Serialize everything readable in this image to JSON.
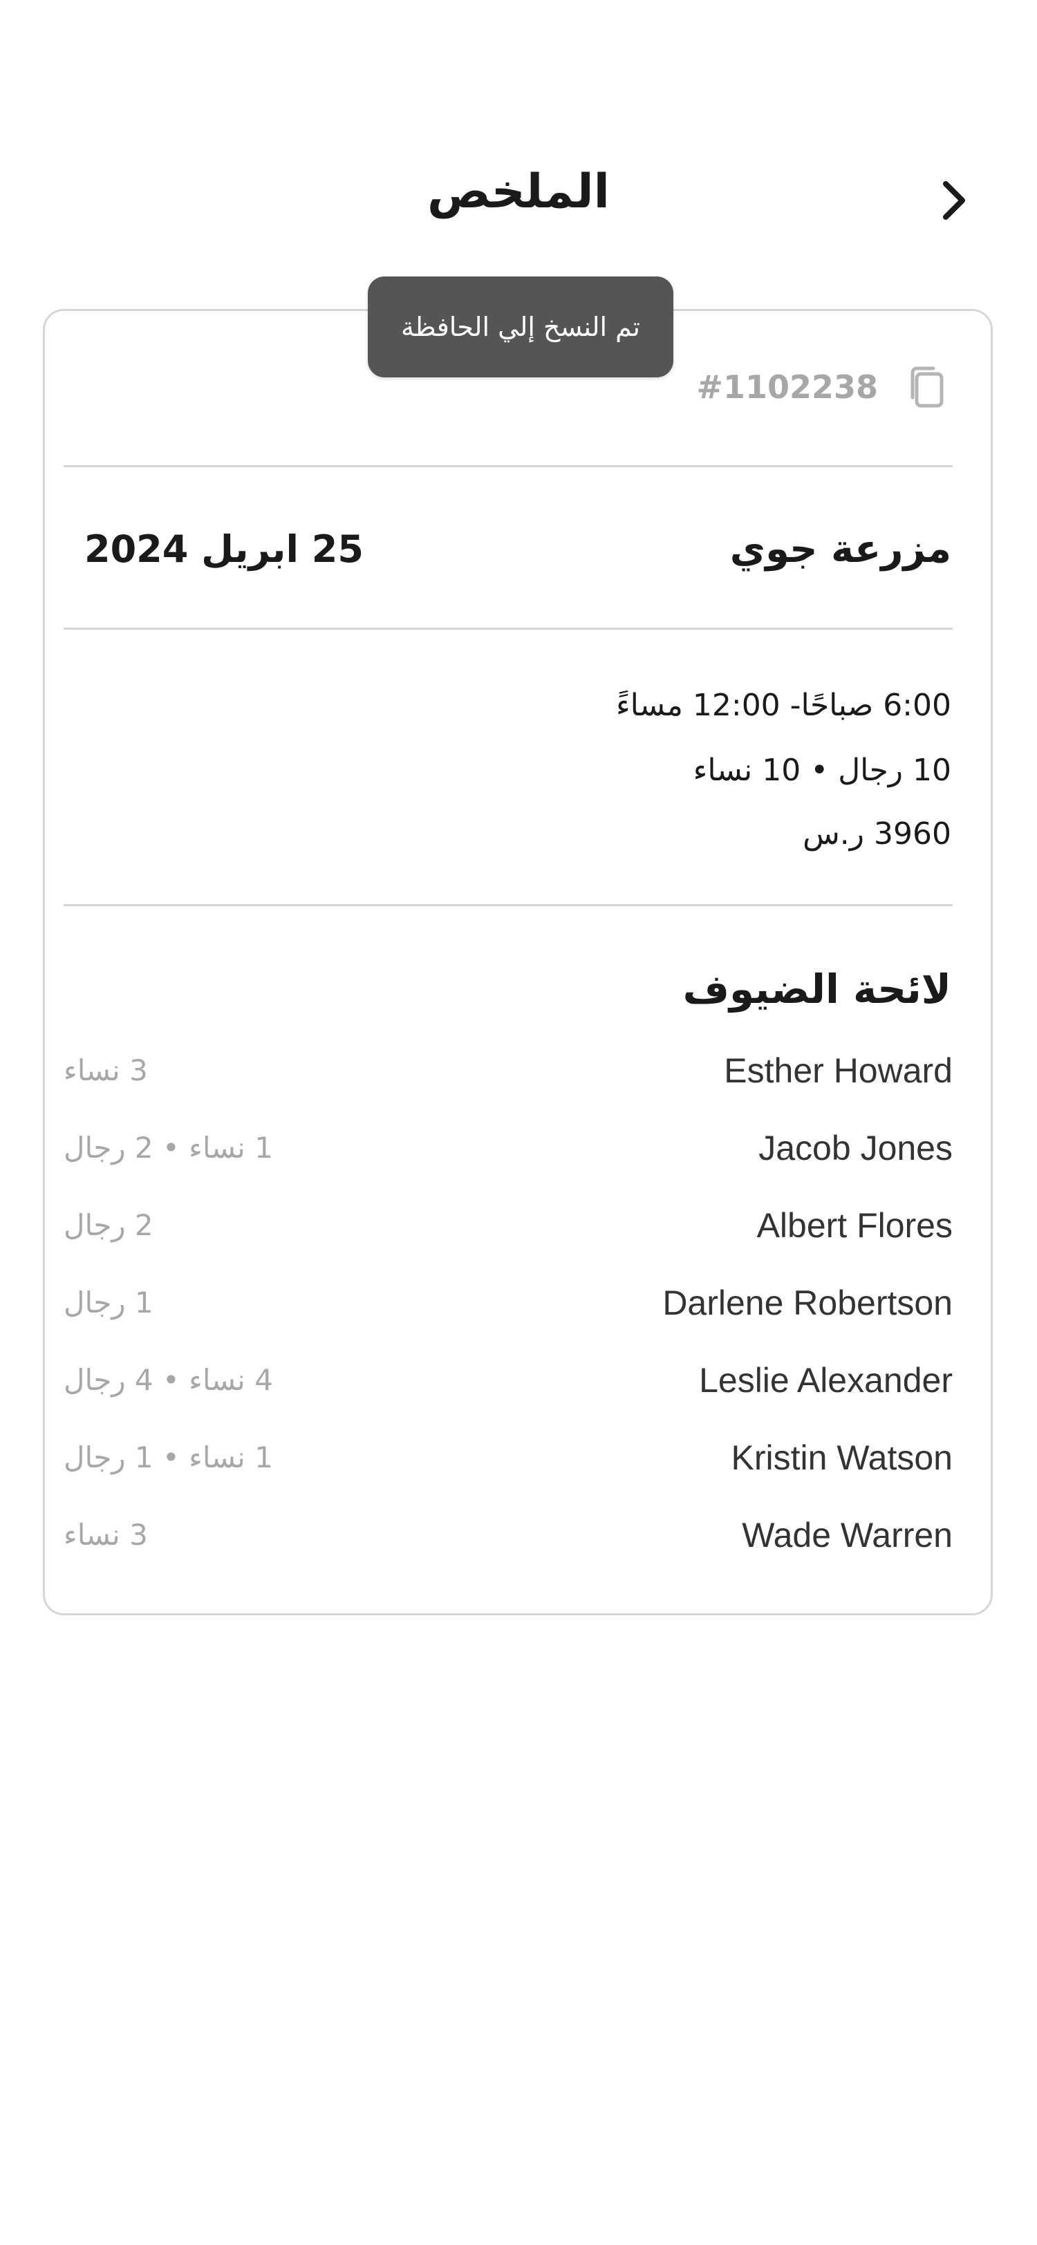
{
  "header": {
    "title": "الملخص",
    "back_icon": "chevron-right-icon"
  },
  "toast": {
    "message": "تم النسخ إلي الحافظة"
  },
  "booking": {
    "id": "#1102238",
    "copy_icon": "copy-icon",
    "venue": "مزرعة جوي",
    "date": "25 ابريل 2024",
    "time": "6:00 صباحًا- 12:00 مساءً",
    "attendees": "10 رجال • 10 نساء",
    "price": "3960  ر.س"
  },
  "guests": {
    "heading": "لائحة الضيوف",
    "items": [
      {
        "name": "Esther Howard",
        "count": "3 نساء"
      },
      {
        "name": "Jacob Jones",
        "count": "1 نساء • 2 رجال"
      },
      {
        "name": "Albert Flores",
        "count": "2 رجال"
      },
      {
        "name": "Darlene Robertson",
        "count": "1 رجال"
      },
      {
        "name": "Leslie Alexander",
        "count": "4 نساء • 4 رجال"
      },
      {
        "name": "Kristin Watson",
        "count": "1 نساء • 1 رجال"
      },
      {
        "name": "Wade Warren",
        "count": "3 نساء"
      }
    ]
  },
  "colors": {
    "toast_bg": "#555555",
    "muted_text": "#a7a7a7",
    "border": "#d6d6d6"
  }
}
